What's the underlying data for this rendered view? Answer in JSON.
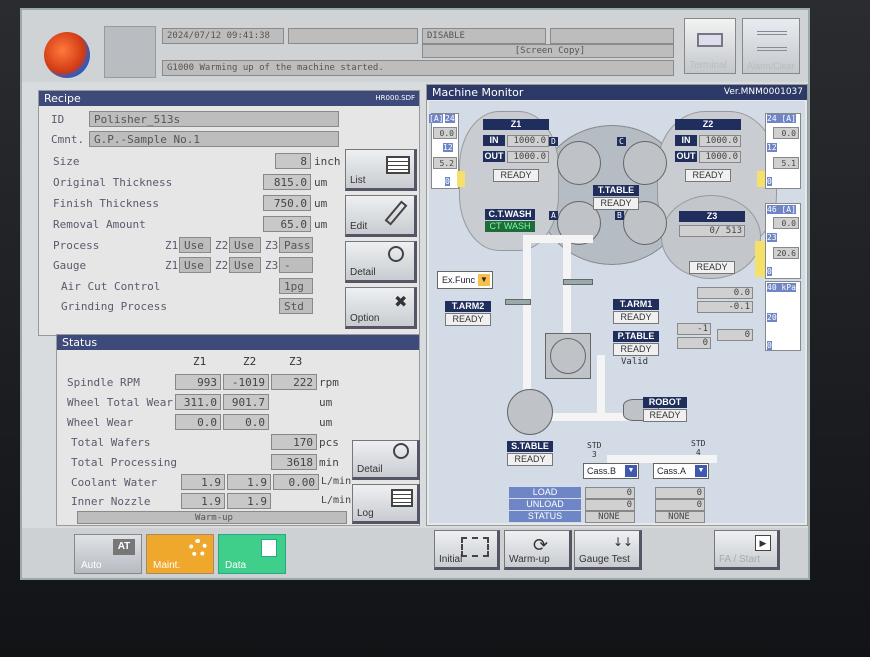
{
  "header": {
    "datetime": "2024/07/12 09:41:38",
    "disable_label": "DISABLE",
    "screen_copy_label": "[Screen Copy]",
    "message": "G1000  Warming up of the machine started.",
    "terminal_label": "Terminal",
    "alarm_label": "Alarm/Clear"
  },
  "recipe": {
    "title": "Recipe",
    "file": "HR000.SDF",
    "id_label": "ID",
    "id_value": "Polisher_513s",
    "cmnt_label": "Cmnt.",
    "cmnt_value": "G.P.-Sample No.1",
    "rows": [
      {
        "label": "Size",
        "value": "8",
        "unit": "inch"
      },
      {
        "label": "Original Thickness",
        "value": "815.0",
        "unit": "um"
      },
      {
        "label": "Finish Thickness",
        "value": "750.0",
        "unit": "um"
      },
      {
        "label": "Removal Amount",
        "value": "65.0",
        "unit": "um"
      }
    ],
    "process_label": "Process",
    "process": {
      "z1": "Use",
      "z2": "Use",
      "z3": "Pass"
    },
    "gauge_label": "Gauge",
    "gauge": {
      "z1": "Use",
      "z2": "Use",
      "z3": "-"
    },
    "z1_tag": "Z1",
    "z2_tag": "Z2",
    "z3_tag": "Z3",
    "aircut_label": "Air Cut Control",
    "aircut_value": "1pg",
    "grinding_label": "Grinding Process",
    "grinding_value": "Std",
    "buttons": {
      "list": "List",
      "edit": "Edit",
      "detail": "Detail",
      "option": "Option"
    }
  },
  "status": {
    "title": "Status",
    "col_z1": "Z1",
    "col_z2": "Z2",
    "col_z3": "Z3",
    "spindle": {
      "label": "Spindle RPM",
      "z1": "993",
      "z2": "-1019",
      "z3": "222",
      "unit": "rpm"
    },
    "wheel_total": {
      "label": "Wheel Total Wear",
      "z1": "311.0",
      "z2": "901.7",
      "unit": "um"
    },
    "wheel_wear": {
      "label": "Wheel Wear",
      "z1": "0.0",
      "z2": "0.0",
      "unit": "um"
    },
    "total_wafers": {
      "label": "Total Wafers",
      "value": "170",
      "unit": "pcs"
    },
    "total_processing": {
      "label": "Total Processing",
      "value": "3618",
      "unit": "min"
    },
    "coolant": {
      "label": "Coolant Water",
      "z1": "1.9",
      "z2": "1.9",
      "z3": "0.00",
      "unit": "L/min"
    },
    "inner": {
      "label": "Inner Nozzle",
      "z1": "1.9",
      "z2": "1.9",
      "unit": "L/min"
    },
    "state": "Warm-up",
    "buttons": {
      "detail": "Detail",
      "log": "Log"
    }
  },
  "monitor": {
    "title": "Machine Monitor",
    "version": "Ver.MNM0001037",
    "z1": {
      "name": "Z1",
      "in_label": "IN",
      "in": "1000.0",
      "out_label": "OUT",
      "out": "1000.0",
      "state": "READY"
    },
    "z2": {
      "name": "Z2",
      "in_label": "IN",
      "in": "1000.0",
      "out_label": "OUT",
      "out": "1000.0",
      "state": "READY"
    },
    "z3": {
      "name": "Z3",
      "val": "0/ 513",
      "state": "READY"
    },
    "left_gauge": {
      "unit": "[A]",
      "top": "24",
      "v1": "0.0",
      "v2": "12",
      "v3": "5.2",
      "v4": "0"
    },
    "right_gauge": {
      "top": "24 [A]",
      "v1": "0.0",
      "v2": "12",
      "v3": "5.1",
      "v4": "0"
    },
    "z3_gauge": {
      "top": "46 [A]",
      "v1": "0.0",
      "v2": "23",
      "v3": "20.6",
      "v4": "0"
    },
    "kpa_gauge": {
      "top": "40 kPa",
      "v2": "20",
      "v4": "0"
    },
    "ttable": {
      "name": "T.TABLE",
      "state": "READY"
    },
    "ctwash": {
      "name": "C.T.WASH",
      "state": "CT WASH"
    },
    "markers": {
      "a": "A",
      "b": "B",
      "c": "C",
      "d": "D"
    },
    "exfunc": "Ex.Func",
    "tarm2": {
      "name": "T.ARM2",
      "state": "READY"
    },
    "tarm1": {
      "name": "T.ARM1",
      "state": "READY"
    },
    "ptable": {
      "name": "P.TABLE",
      "state": "READY",
      "valid": "Valid"
    },
    "arm_vals": {
      "v1": "0.0",
      "v2": "-0.1",
      "v3": "-1",
      "v4": "0",
      "v5": "0"
    },
    "robot": {
      "name": "ROBOT",
      "state": "READY"
    },
    "stable": {
      "name": "S.TABLE",
      "state": "READY"
    },
    "std3": "STD\n3",
    "std4": "STD\n4",
    "cassb": "Cass.B",
    "cassa": "Cass.A",
    "load_label": "LOAD",
    "unload_label": "UNLOAD",
    "status_label": "STATUS",
    "cassb_vals": {
      "load": "0",
      "unload": "0",
      "status": "NONE"
    },
    "cassa_vals": {
      "load": "0",
      "unload": "0",
      "status": "NONE"
    }
  },
  "footer": {
    "auto": "Auto",
    "maint": "Maint.",
    "data": "Data",
    "initial": "Initial",
    "warmup": "Warm-up",
    "gauge_test": "Gauge Test",
    "fa_start": "FA / Start"
  },
  "colors": {
    "header_blue": "#3d4a7a",
    "maint_orange": "#f0a82c",
    "data_green": "#3fcf8a",
    "gauge_yellow": "#f5e06a"
  }
}
